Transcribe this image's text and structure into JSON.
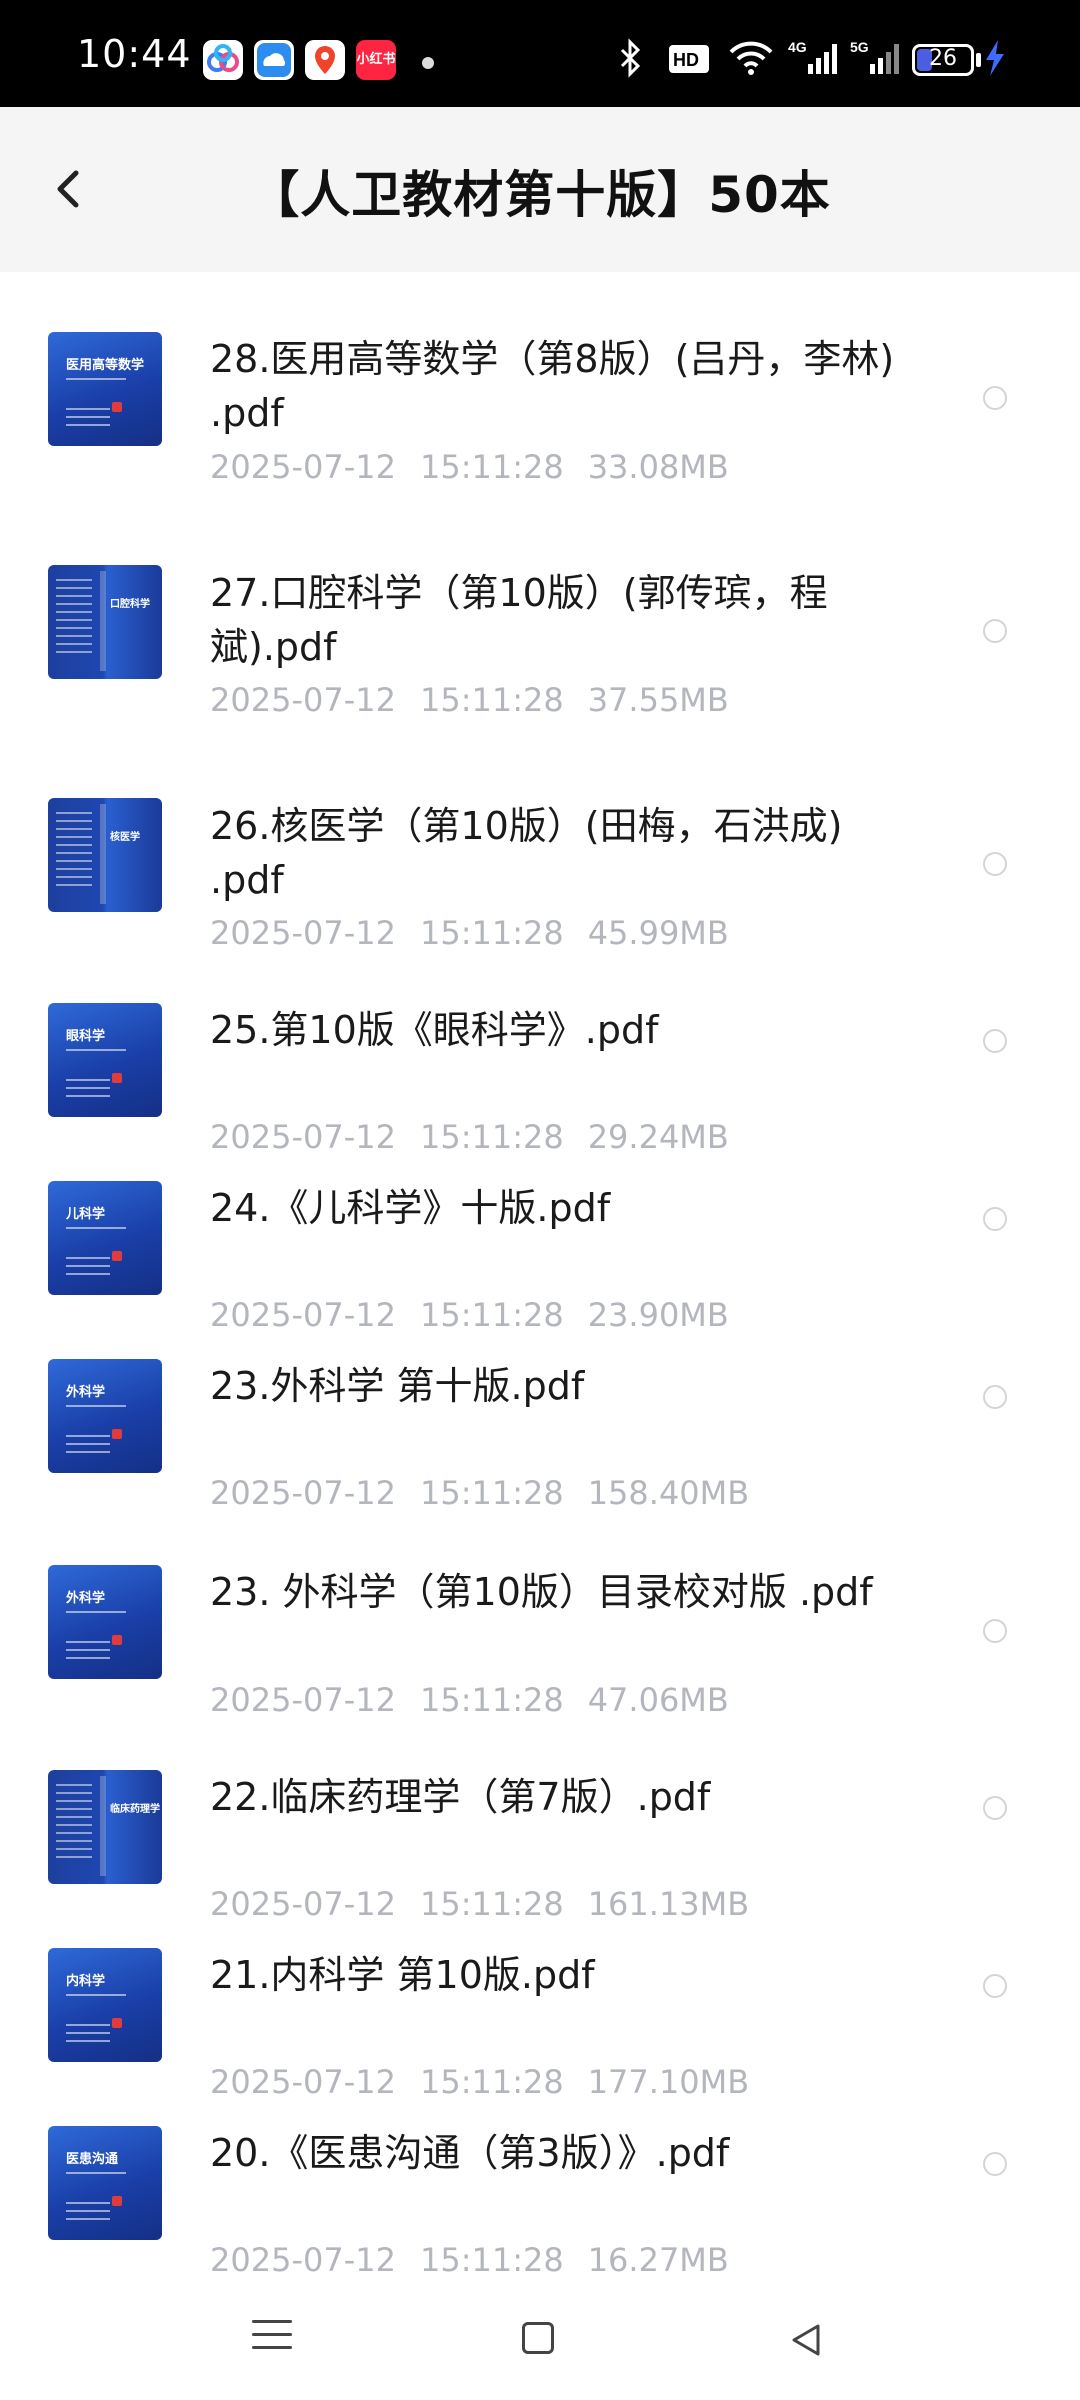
{
  "status_bar": {
    "time": "10:44",
    "battery": "26",
    "apps": [
      {
        "icon": "baidu-netdisk-icon",
        "color": "#ffffff"
      },
      {
        "icon": "cloud-app-icon",
        "color": "#ffffff"
      },
      {
        "icon": "map-pin-app-icon",
        "color": "#ffffff"
      },
      {
        "icon": "xiaohongshu-icon",
        "label": "小红书",
        "color": "#ff2442"
      }
    ],
    "indicators": [
      "bluetooth-icon",
      "hd-icon",
      "wifi-icon",
      "4g-signal-icon",
      "5g-signal-icon"
    ]
  },
  "header": {
    "title": "【人卫教材第十版】50本",
    "back_icon": "chevron-left-icon"
  },
  "files": [
    {
      "name": "28.医用高等数学（第8版）(吕丹，李林) .pdf",
      "date": "2025-07-12",
      "time": "15:11:28",
      "size": "33.08MB",
      "cover_label": "医用高等数学"
    },
    {
      "name": "27.口腔科学（第10版）(郭传瑸，程斌).pdf",
      "date": "2025-07-12",
      "time": "15:11:28",
      "size": "37.55MB",
      "cover_label": "口腔科学"
    },
    {
      "name": "26.核医学（第10版）(田梅，石洪成) .pdf",
      "date": "2025-07-12",
      "time": "15:11:28",
      "size": "45.99MB",
      "cover_label": "核医学"
    },
    {
      "name": "25.第10版《眼科学》.pdf",
      "date": "2025-07-12",
      "time": "15:11:28",
      "size": "29.24MB",
      "cover_label": "眼科学"
    },
    {
      "name": "24.《儿科学》十版.pdf",
      "date": "2025-07-12",
      "time": "15:11:28",
      "size": "23.90MB",
      "cover_label": "儿科学"
    },
    {
      "name": "23.外科学 第十版.pdf",
      "date": "2025-07-12",
      "time": "15:11:28",
      "size": "158.40MB",
      "cover_label": "外科学"
    },
    {
      "name": "23. 外科学（第10版）目录校对版 .pdf",
      "date": "2025-07-12",
      "time": "15:11:28",
      "size": "47.06MB",
      "cover_label": "外科学"
    },
    {
      "name": "22.临床药理学（第7版）.pdf",
      "date": "2025-07-12",
      "time": "15:11:28",
      "size": "161.13MB",
      "cover_label": "临床药理学"
    },
    {
      "name": "21.内科学 第10版.pdf",
      "date": "2025-07-12",
      "time": "15:11:28",
      "size": "177.10MB",
      "cover_label": "内科学"
    },
    {
      "name": "20.《医患沟通（第3版）》.pdf",
      "date": "2025-07-12",
      "time": "15:11:28",
      "size": "16.27MB",
      "cover_label": "医患沟通"
    }
  ],
  "nav": [
    "menu-icon",
    "home-icon",
    "back-triangle-icon"
  ]
}
